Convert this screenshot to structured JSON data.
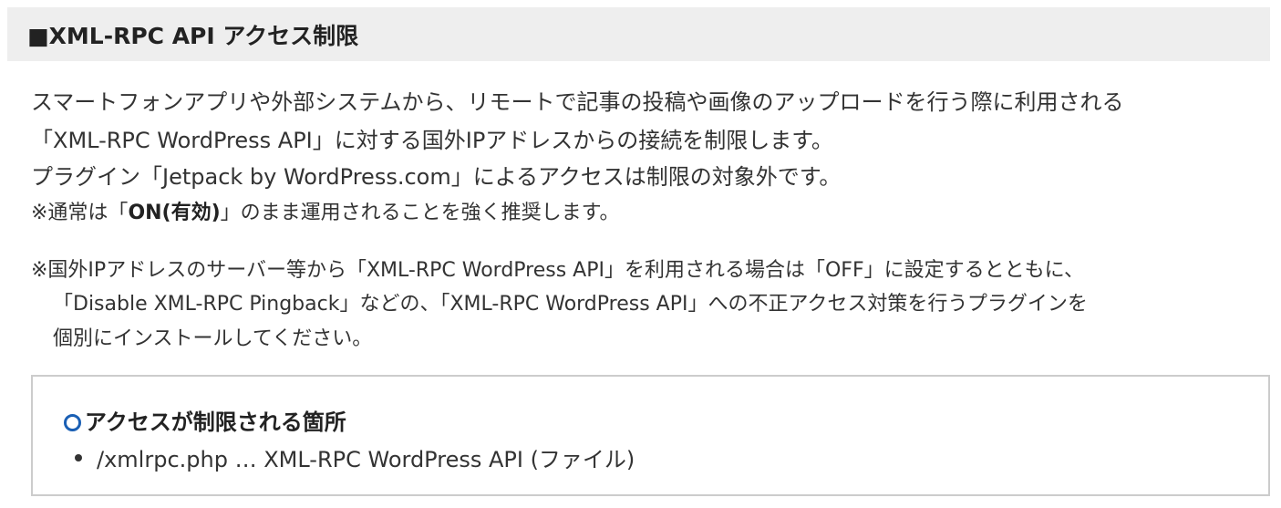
{
  "section": {
    "title": "■XML-RPC API アクセス制限"
  },
  "description": {
    "line1": "スマートフォンアプリや外部システムから、リモートで記事の投稿や画像のアップロードを行う際に利用される",
    "line2": "「XML-RPC WordPress API」に対する国外IPアドレスからの接続を制限します。",
    "line3": "プラグイン「Jetpack by WordPress.com」によるアクセスは制限の対象外です。",
    "line4_prefix": "※通常は「",
    "line4_bold": "ON(有効)",
    "line4_suffix": "」のまま運用されることを強く推奨します。"
  },
  "note": {
    "line1": "※国外IPアドレスのサーバー等から「XML-RPC WordPress API」を利用される場合は「OFF」に設定するとともに、",
    "line2": "「Disable XML-RPC Pingback」などの、「XML-RPC WordPress API」への不正アクセス対策を行うプラグインを",
    "line3": "個別にインストールしてください。"
  },
  "restricted_box": {
    "title": "アクセスが制限される箇所",
    "items": [
      "/xmlrpc.php … XML-RPC WordPress API (ファイル)"
    ]
  }
}
